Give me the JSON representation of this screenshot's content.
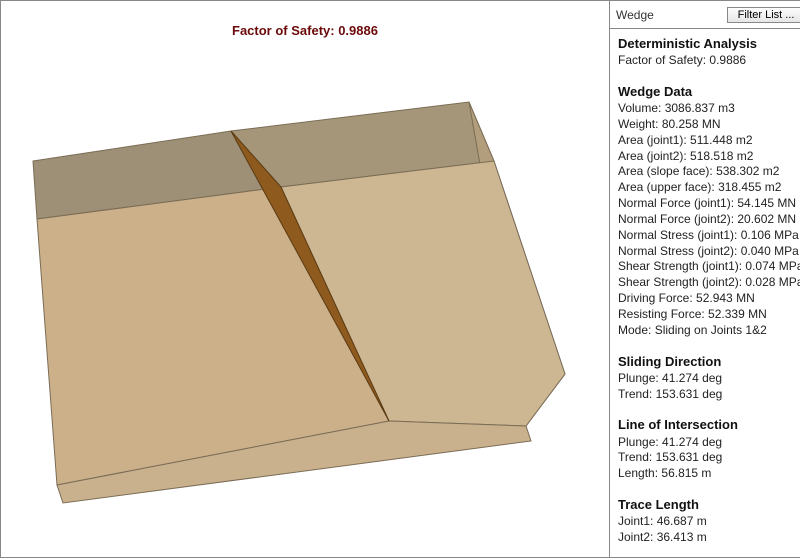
{
  "viewport": {
    "title_prefix": "Factor of Safety: ",
    "fos": "0.9886"
  },
  "side": {
    "toolbar": {
      "label": "Wedge",
      "filter_label": "Filter List ..."
    },
    "sections": {
      "deterministic": {
        "heading": "Deterministic Analysis",
        "fos_label": "Factor of Safety:",
        "fos": "0.9886"
      },
      "wedge_data": {
        "heading": "Wedge Data",
        "rows": [
          {
            "label": "Volume:",
            "value": "3086.837 m3"
          },
          {
            "label": "Weight:",
            "value": "80.258 MN"
          },
          {
            "label": "Area (joint1):",
            "value": "511.448 m2"
          },
          {
            "label": "Area (joint2):",
            "value": "518.518 m2"
          },
          {
            "label": "Area (slope face):",
            "value": "538.302 m2"
          },
          {
            "label": "Area (upper face):",
            "value": "318.455 m2"
          },
          {
            "label": "Normal Force (joint1):",
            "value": "54.145 MN"
          },
          {
            "label": "Normal Force (joint2):",
            "value": "20.602 MN"
          },
          {
            "label": "Normal Stress (joint1):",
            "value": "0.106 MPa"
          },
          {
            "label": "Normal Stress (joint2):",
            "value": "0.040 MPa"
          },
          {
            "label": "Shear Strength (joint1):",
            "value": "0.074 MPa"
          },
          {
            "label": "Shear Strength (joint2):",
            "value": "0.028 MPa"
          },
          {
            "label": "Driving Force:",
            "value": "52.943 MN"
          },
          {
            "label": "Resisting Force:",
            "value": "52.339 MN"
          },
          {
            "label": "Mode:",
            "value": "Sliding on Joints 1&2"
          }
        ]
      },
      "sliding_direction": {
        "heading": "Sliding Direction",
        "rows": [
          {
            "label": "Plunge:",
            "value": "41.274 deg"
          },
          {
            "label": "Trend:",
            "value": "153.631 deg"
          }
        ]
      },
      "line_of_intersection": {
        "heading": "Line of Intersection",
        "rows": [
          {
            "label": "Plunge:",
            "value": "41.274 deg"
          },
          {
            "label": "Trend:",
            "value": "153.631 deg"
          },
          {
            "label": "Length:",
            "value": "56.815 m"
          }
        ]
      },
      "trace_length": {
        "heading": "Trace Length",
        "rows": [
          {
            "label": "Joint1:",
            "value": "46.687 m"
          },
          {
            "label": "Joint2:",
            "value": "36.413 m"
          }
        ]
      }
    }
  }
}
